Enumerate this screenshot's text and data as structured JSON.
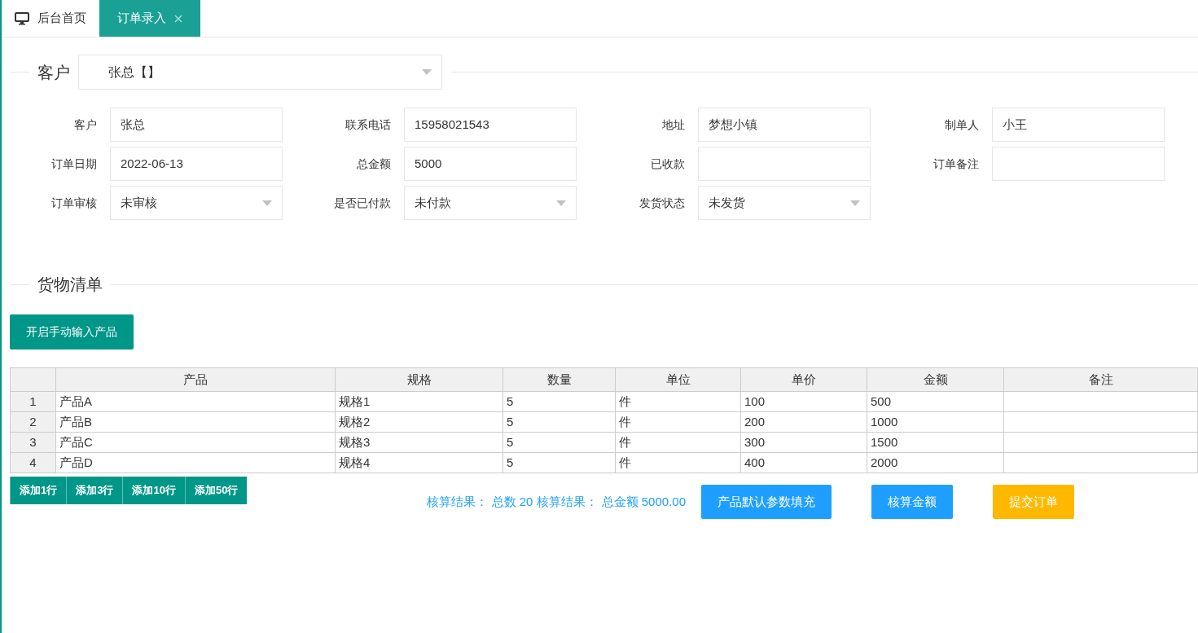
{
  "tabs": [
    {
      "label": "后台首页",
      "kind": "home",
      "selected": false
    },
    {
      "label": "订单录入",
      "kind": "closable",
      "selected": true
    }
  ],
  "customer_section": {
    "legend": "客户",
    "select_value": "张总【】"
  },
  "form": {
    "fields": [
      {
        "label": "客户",
        "value": "张总",
        "kind": "text"
      },
      {
        "label": "联系电话",
        "value": "15958021543",
        "kind": "text"
      },
      {
        "label": "地址",
        "value": "梦想小镇",
        "kind": "text"
      },
      {
        "label": "制单人",
        "value": "小王",
        "kind": "text"
      },
      {
        "label": "订单日期",
        "value": "2022-06-13",
        "kind": "text"
      },
      {
        "label": "总金额",
        "value": "5000",
        "kind": "text"
      },
      {
        "label": "已收款",
        "kind": "text"
      },
      {
        "label": "订单备注",
        "kind": "text"
      },
      {
        "label": "订单审核",
        "value": "未审核",
        "kind": "select"
      },
      {
        "label": "是否已付款",
        "value": "未付款",
        "kind": "select"
      },
      {
        "label": "发货状态",
        "value": "未发货",
        "kind": "select"
      }
    ]
  },
  "goods_section": {
    "legend": "货物清单",
    "manual_button": "开启手动输入产品"
  },
  "table": {
    "columns": [
      "产品",
      "规格",
      "数量",
      "单位",
      "单价",
      "金额",
      "备注"
    ],
    "rows": [
      {
        "index": "1",
        "cells": [
          "产品A",
          "规格1",
          "5",
          "件",
          "100",
          "500",
          ""
        ]
      },
      {
        "index": "2",
        "cells": [
          "产品B",
          "规格2",
          "5",
          "件",
          "200",
          "1000",
          ""
        ]
      },
      {
        "index": "3",
        "cells": [
          "产品C",
          "规格3",
          "5",
          "件",
          "300",
          "1500",
          ""
        ]
      },
      {
        "index": "4",
        "cells": [
          "产品D",
          "规格4",
          "5",
          "件",
          "400",
          "2000",
          ""
        ]
      }
    ]
  },
  "add_buttons": [
    "添加1行",
    "添加3行",
    "添加10行",
    "添加50行"
  ],
  "summary": [
    "核算结果： 总数 20",
    "核算结果： 总金额 5000.00"
  ],
  "action_buttons": [
    {
      "label": "产品默认参数填充",
      "kind": "primary"
    },
    {
      "label": "核算金额",
      "kind": "primary"
    },
    {
      "label": "提交订单",
      "kind": "warning"
    }
  ]
}
